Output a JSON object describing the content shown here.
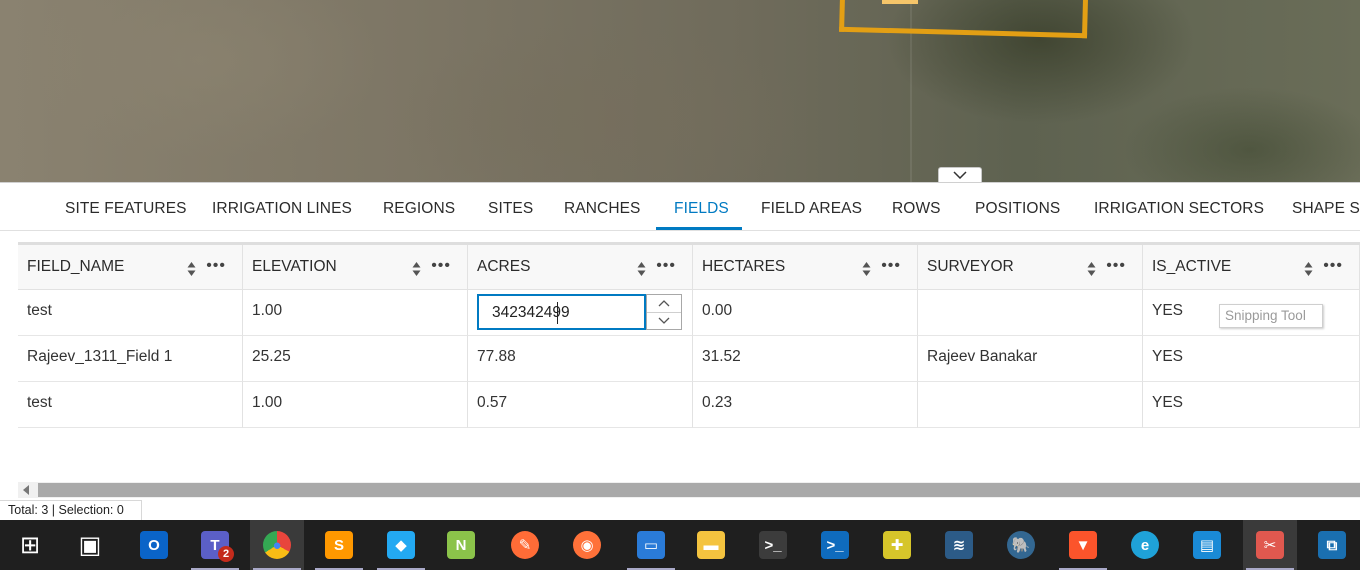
{
  "tabs": [
    {
      "label": "SITE FEATURES",
      "active": false
    },
    {
      "label": "IRRIGATION LINES",
      "active": false
    },
    {
      "label": "REGIONS",
      "active": false
    },
    {
      "label": "SITES",
      "active": false
    },
    {
      "label": "RANCHES",
      "active": false
    },
    {
      "label": "FIELDS",
      "active": true
    },
    {
      "label": "FIELD AREAS",
      "active": false
    },
    {
      "label": "ROWS",
      "active": false
    },
    {
      "label": "POSITIONS",
      "active": false
    },
    {
      "label": "IRRIGATION SECTORS",
      "active": false
    },
    {
      "label": "SHAPE SE",
      "active": false
    }
  ],
  "table": {
    "columns": [
      "FIELD_NAME",
      "ELEVATION",
      "ACRES",
      "HECTARES",
      "SURVEYOR",
      "IS_ACTIVE"
    ],
    "rows": [
      [
        "test",
        "1.00",
        "",
        "0.00",
        "",
        "YES"
      ],
      [
        "Rajeev_1311_Field 1",
        "25.25",
        "77.88",
        "31.52",
        "Rajeev Banakar",
        "YES"
      ],
      [
        "test",
        "1.00",
        "0.57",
        "0.23",
        "",
        "YES"
      ]
    ],
    "editing_value": "342342499"
  },
  "tooltip": "Snipping Tool",
  "footer": {
    "status": "Total: 3 | Selection: 0"
  },
  "taskbar": {
    "teams_badge": "2",
    "apps": [
      {
        "name": "windows-start",
        "color": "#ffffff"
      },
      {
        "name": "task-view",
        "color": "#ffffff"
      },
      {
        "name": "outlook",
        "color": "#0a64c8"
      },
      {
        "name": "teams",
        "color": "#5b5fc7"
      },
      {
        "name": "chrome",
        "color": "#e8453c"
      },
      {
        "name": "sublime-text",
        "color": "#ff9800"
      },
      {
        "name": "vscode",
        "color": "#23a9f2"
      },
      {
        "name": "notepad-plus-plus",
        "color": "#8bc34a"
      },
      {
        "name": "postman",
        "color": "#ff6c37"
      },
      {
        "name": "firefox",
        "color": "#ff7139"
      },
      {
        "name": "remote-desktop",
        "color": "#2a7bd8"
      },
      {
        "name": "file-explorer",
        "color": "#f4c33f"
      },
      {
        "name": "terminal",
        "color": "#3c3c3c"
      },
      {
        "name": "powershell",
        "color": "#0f6bbd"
      },
      {
        "name": "color-picker",
        "color": "#d6c52a"
      },
      {
        "name": "mysql-workbench",
        "color": "#2c5b87"
      },
      {
        "name": "pgadmin",
        "color": "#336791"
      },
      {
        "name": "brave",
        "color": "#fb542b"
      },
      {
        "name": "edge",
        "color": "#1fa2d8"
      },
      {
        "name": "remote-app",
        "color": "#1a8ad6"
      },
      {
        "name": "snipping-tool",
        "color": "#e0584f"
      },
      {
        "name": "desktop-switch",
        "color": "#1a6fb0"
      }
    ]
  }
}
